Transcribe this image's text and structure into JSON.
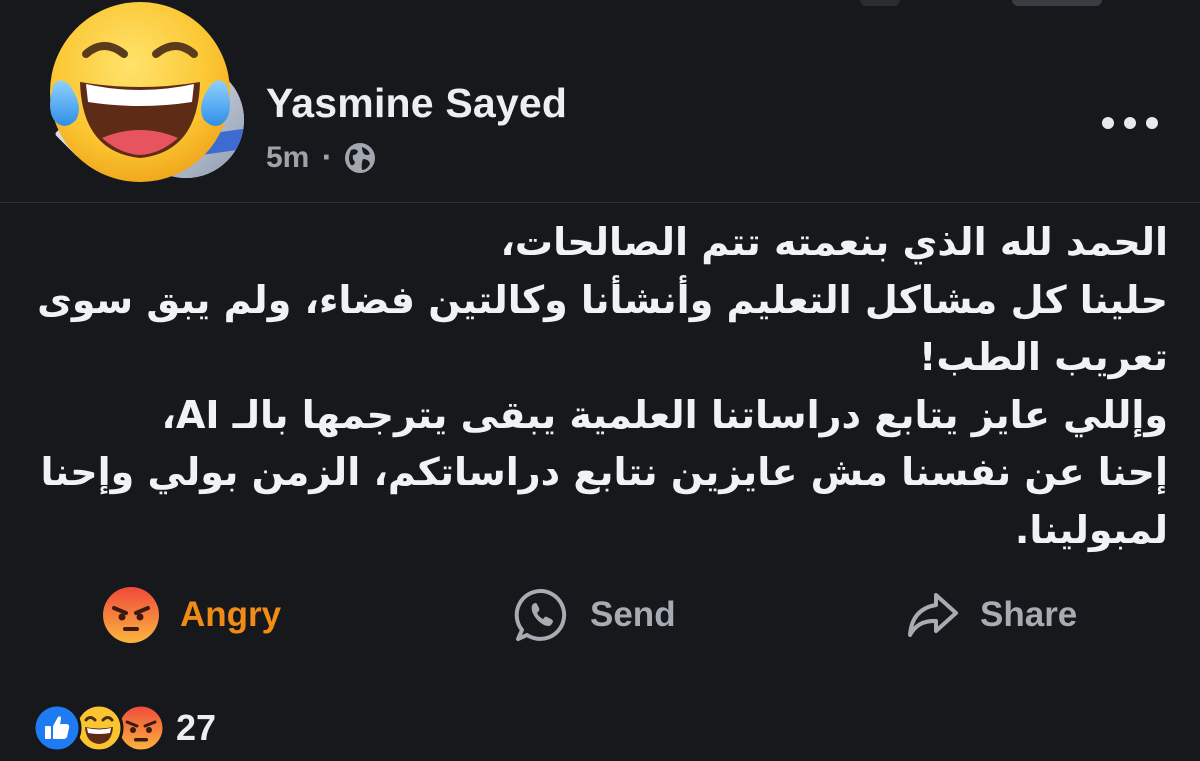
{
  "post": {
    "author": "Yasmine Sayed",
    "time": "5m",
    "separator": "·",
    "privacy_icon": "globe-icon",
    "body_lines": [
      "الحمد لله الذي بنعمته تتم الصالحات،",
      "حلينا كل مشاكل التعليم وأنشأنا وكالتين فضاء، ولم يبق سوى",
      "تعريب الطب!",
      "وإللي عايز يتابع دراساتنا العلمية يبقى يترجمها بالـ AI،",
      "إحنا عن نفسنا مش عايزين نتابع دراساتكم، الزمن بولي وإحنا",
      "لمبولينا."
    ]
  },
  "actions": {
    "reaction_label": "Angry",
    "send_label": "Send",
    "share_label": "Share"
  },
  "reactions": {
    "icons": [
      "like-icon",
      "laughing-icon",
      "angry-icon"
    ],
    "count": "27"
  },
  "colors": {
    "background": "#17181b",
    "angry_accent": "#f08c16",
    "muted_text": "#a7abb3",
    "like_blue": "#1f7bf2"
  }
}
